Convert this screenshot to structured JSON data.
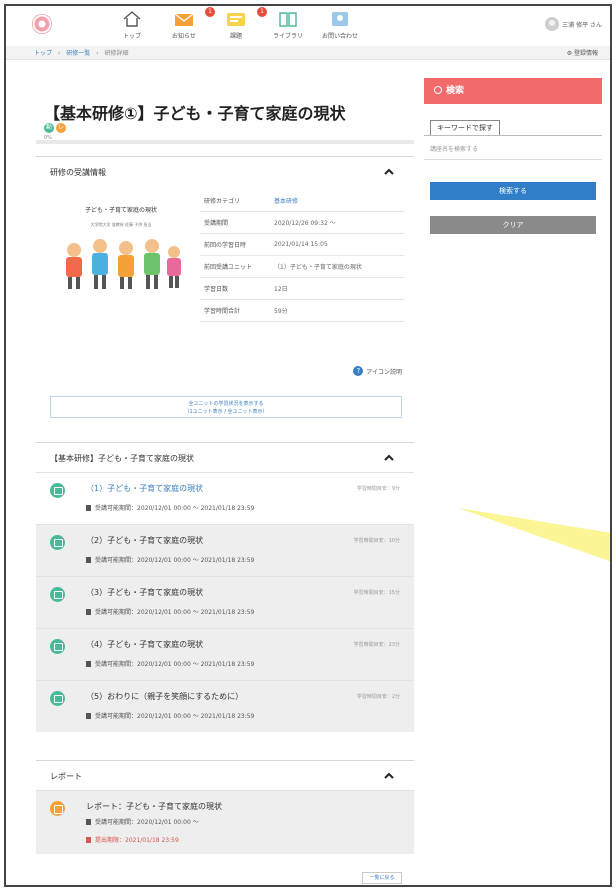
{
  "header": {
    "nav": [
      {
        "label": "トップ",
        "icon": "home-icon",
        "badge": ""
      },
      {
        "label": "お知らせ",
        "icon": "mail-icon",
        "badge": "1"
      },
      {
        "label": "課題",
        "icon": "task-icon",
        "badge": "1"
      },
      {
        "label": "ライブラリ",
        "icon": "book-icon",
        "badge": ""
      },
      {
        "label": "お問い合わせ",
        "icon": "contact-icon",
        "badge": ""
      }
    ],
    "user_name": "三浦 修平 さん",
    "settings_label": "⚙ 登録情報"
  },
  "breadcrumb": [
    "トップ",
    "›",
    "研修一覧",
    "›",
    "研修詳細"
  ],
  "page": {
    "title": "【基本研修①】子ども・子育て家庭の現状",
    "icon_text_1": "動",
    "icon_text_2": "レ",
    "small_label": "0%"
  },
  "info_panel": {
    "heading": "研修の受講情報",
    "thumb_title": "子ども・子育て家庭の現状",
    "thumb_subtitle": "大学院大学 准教授 佐藤 子供 担当",
    "rows": [
      {
        "label": "研修カテゴリ",
        "value": "基本研修"
      },
      {
        "label": "受講期間",
        "value": "2020/12/26 09:32 〜"
      },
      {
        "label": "前回の学習日時",
        "value": "2021/01/14 15:05"
      },
      {
        "label": "前回受講ユニット",
        "value": "（1）子ども・子育て家庭の現状"
      },
      {
        "label": "学習日数",
        "value": "12日"
      },
      {
        "label": "学習時間合計",
        "value": "59分"
      }
    ],
    "icon_help": "アイコン説明",
    "unit_button_line1": "全ユニットの学習状況を表示する",
    "unit_button_line2": "（1ユニット表示 / 全ユニット表示）"
  },
  "units_panel": {
    "heading": "【基本研修】子ども・子育て家庭の現状",
    "units": [
      {
        "title": "（1）子ども・子育て家庭の現状",
        "time": "学習時間目安：9分",
        "period": "受講可能期間：2020/12/01 00:00 〜 2021/01/18 23:59"
      },
      {
        "title": "（2）子ども・子育て家庭の現状",
        "time": "学習時間目安：10分",
        "period": "受講可能期間：2020/12/01 00:00 〜 2021/01/18 23:59"
      },
      {
        "title": "（3）子ども・子育て家庭の現状",
        "time": "学習時間目安：15分",
        "period": "受講可能期間：2020/12/01 00:00 〜 2021/01/18 23:59"
      },
      {
        "title": "（4）子ども・子育て家庭の現状",
        "time": "学習時間目安：23分",
        "period": "受講可能期間：2020/12/01 00:00 〜 2021/01/18 23:59"
      },
      {
        "title": "（5）おわりに（親子を笑顔にするために）",
        "time": "学習時間目安：2分",
        "period": "受講可能期間：2020/12/01 00:00 〜 2021/01/18 23:59"
      }
    ]
  },
  "report_panel": {
    "heading": "レポート",
    "title": "レポート：子ども・子育て家庭の現状",
    "period": "受講可能期間：2020/12/01 00:00 〜",
    "deadline": "提出期限：2021/01/18 23:59",
    "back_label": "一覧に戻る"
  },
  "search": {
    "heading": "検索",
    "keyword_tab": "キーワードで探す",
    "placeholder": "講座名を検索する",
    "submit": "検索する",
    "clear": "クリア"
  },
  "colors": {
    "accent_blue": "#2f7ec7",
    "search_red": "#f36a6a",
    "unit_green": "#4bb89a",
    "report_orange": "#f4a13a",
    "annotation_yellow": "#fbf48a"
  }
}
